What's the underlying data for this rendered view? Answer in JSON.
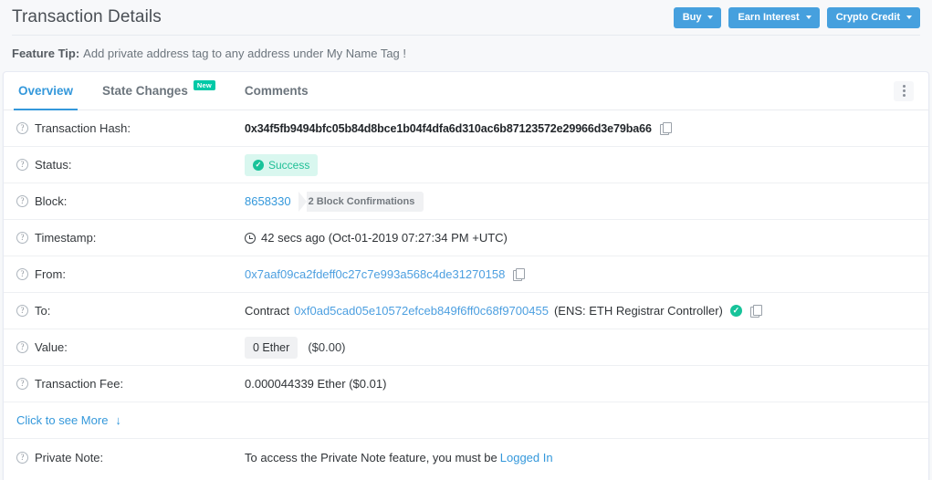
{
  "header": {
    "title": "Transaction Details",
    "buttons": [
      {
        "label": "Buy",
        "has_caret": true
      },
      {
        "label": "Earn Interest",
        "has_caret": true
      },
      {
        "label": "Crypto Credit",
        "has_caret": true
      }
    ]
  },
  "feature_tip": {
    "prefix": "Feature Tip:",
    "text": "Add private address tag to any address under My Name Tag !"
  },
  "tabs": [
    {
      "label": "Overview",
      "active": true,
      "badge": ""
    },
    {
      "label": "State Changes",
      "active": false,
      "badge": "New"
    },
    {
      "label": "Comments",
      "active": false,
      "badge": ""
    }
  ],
  "menu": {
    "icon": "kebab-menu-icon"
  },
  "rows": {
    "transaction_hash": {
      "label": "Transaction Hash:",
      "value": "0x34f5fb9494bfc05b84d8bce1b04f4dfa6d310ac6b87123572e29966d3e79ba66"
    },
    "status": {
      "label": "Status:",
      "value": "Success"
    },
    "block": {
      "label": "Block:",
      "number": "8658330",
      "confirmations": "2 Block Confirmations"
    },
    "timestamp": {
      "label": "Timestamp:",
      "value": "42 secs ago (Oct-01-2019 07:27:34 PM +UTC)"
    },
    "from": {
      "label": "From:",
      "address": "0x7aaf09ca2fdeff0c27c7e993a568c4de31270158"
    },
    "to": {
      "label": "To:",
      "prefix": "Contract",
      "address": "0xf0ad5cad05e10572efceb849f6ff0c68f9700455",
      "ens": "(ENS: ETH Registrar Controller)"
    },
    "value": {
      "label": "Value:",
      "amount": "0 Ether",
      "usd": "($0.00)"
    },
    "transaction_fee": {
      "label": "Transaction Fee:",
      "value": "0.000044339 Ether ($0.01)"
    },
    "click_more": {
      "label": "Click to see More",
      "arrow": "↓"
    },
    "private_note": {
      "label": "Private Note:",
      "text": "To access the Private Note feature, you must be",
      "link": "Logged In"
    }
  },
  "colors": {
    "accent_blue": "#3498db",
    "button_blue": "#46a0de",
    "success_green": "#1fbf96",
    "badge_new": "#00c9a7",
    "page_bg": "#f7f8fa"
  }
}
